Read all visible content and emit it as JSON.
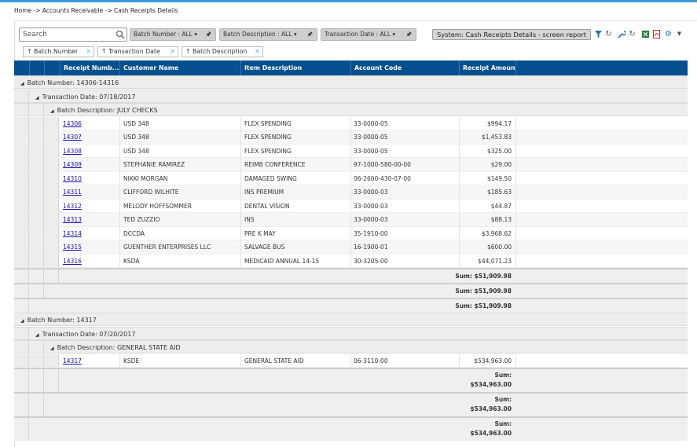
{
  "breadcrumb": "Home -> Accounts Receivable -> Cash Receipts Details",
  "search": {
    "placeholder": "Search"
  },
  "filters": [
    {
      "label": "Batch Number : ALL ▾"
    },
    {
      "label": "Batch Description : ALL ▾"
    },
    {
      "label": "Transaction Date : ALL ▾"
    }
  ],
  "system_button": "System: Cash Receipts Details - screen report",
  "group_chips": [
    {
      "label": "Batch Number"
    },
    {
      "label": "Transaction Date"
    },
    {
      "label": "Batch Description"
    }
  ],
  "columns": [
    "Receipt Numb...",
    "Customer Name",
    "Item Description",
    "Account Code",
    "Receipt Amount"
  ],
  "groups": [
    {
      "batch": "Batch Number: 14306-14316",
      "date": "Transaction Date: 07/18/2017",
      "description": "Batch Description: JULY CHECKS",
      "rows": [
        [
          "14306",
          "USD 348",
          "FLEX SPENDING",
          "33-0000-05",
          "$994.17"
        ],
        [
          "14307",
          "USD 348",
          "FLEX SPENDING",
          "33-0000-05",
          "$1,453.83"
        ],
        [
          "14308",
          "USD 348",
          "FLEX SPENDING",
          "33-0000-05",
          "$325.00"
        ],
        [
          "14309",
          "STEPHANIE RAMIREZ",
          "REIMB CONFERENCE",
          "97-1000-580-00-00",
          "$29.00"
        ],
        [
          "14310",
          "NIKKI MORGAN",
          "DAMAGED SWING",
          "06-2600-430-07-00",
          "$149.50"
        ],
        [
          "14311",
          "CLIFFORD WILHITE",
          "INS PREMIUM",
          "33-0000-03",
          "$185.63"
        ],
        [
          "14312",
          "MELODY HOFFSOMMER",
          "DENTAL VISION",
          "33-0000-03",
          "$44.87"
        ],
        [
          "14313",
          "TED ZUZZIO",
          "INS",
          "33-0000-03",
          "$88.13"
        ],
        [
          "14314",
          "DCCDA",
          "PRE K MAY",
          "35-1910-00",
          "$3,968.62"
        ],
        [
          "14315",
          "GUENTHER ENTERPRISES LLC",
          "SALVAGE BUS",
          "16-1900-01",
          "$600.00"
        ],
        [
          "14316",
          "KSDA",
          "MEDICAID ANNUAL 14-15",
          "30-3205-00",
          "$44,071.23"
        ]
      ],
      "sums": [
        "Sum: $51,909.98",
        "Sum: $51,909.98",
        "Sum: $51,909.98"
      ]
    },
    {
      "batch": "Batch Number: 14317",
      "date": "Transaction Date: 07/20/2017",
      "description": "Batch Description: GENERAL STATE AID",
      "rows": [
        [
          "14317",
          "KSDE",
          "GENERAL STATE AID",
          "06-3110-00",
          "$534,963.00"
        ]
      ],
      "sums": [
        [
          "Sum:",
          "$534,963.00"
        ],
        [
          "Sum:",
          "$534,963.00"
        ],
        [
          "Sum:",
          "$534,963.00"
        ]
      ]
    }
  ],
  "icons": [
    "search-icon",
    "filter-icon",
    "refresh-icon",
    "wrench-icon",
    "refresh-icon",
    "excel-icon",
    "pdf-icon",
    "gear-icon",
    "chevron-down-icon",
    "pin-icon",
    "close-icon",
    "sort-up-icon",
    "expand-triangle-icon"
  ],
  "colors": {
    "header": "#05508e",
    "accent_bar": "#3a9ad9",
    "link": "#1a0dab",
    "group_bg": "#ededed"
  }
}
